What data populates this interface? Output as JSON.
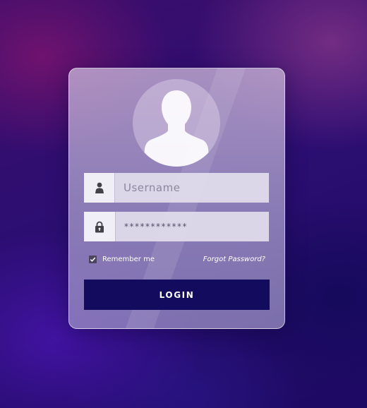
{
  "login_form": {
    "username_placeholder": "Username",
    "password_value": "************",
    "remember_label": "Remember me",
    "remember_checked": true,
    "forgot_label": "Forgot Password?",
    "login_label": "LOGIN"
  },
  "icons": {
    "avatar": "user-silhouette-icon",
    "username": "person-icon",
    "password": "padlock-icon",
    "checkbox": "checkmark-icon"
  },
  "colors": {
    "button_background": "#120b5e",
    "card_tint": "#b9aed6",
    "field_background": "#e6e3ef",
    "icon_color": "#3a3a3a"
  }
}
